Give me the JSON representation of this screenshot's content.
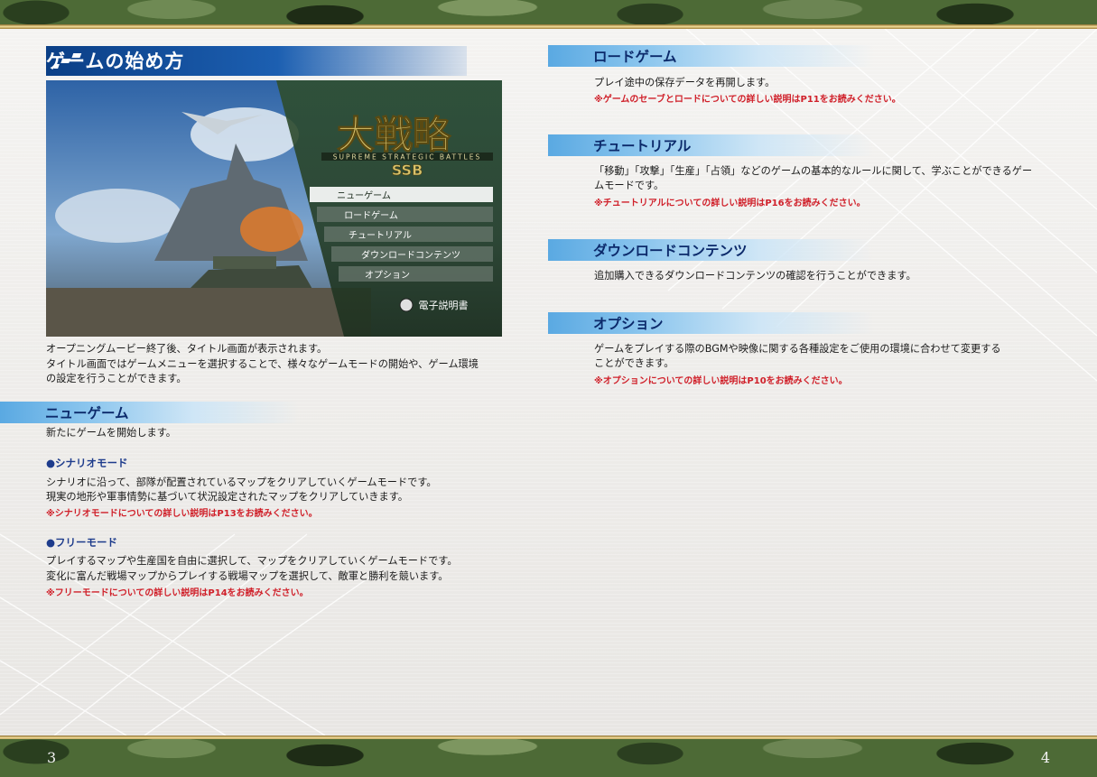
{
  "page": {
    "left_number": "3",
    "right_number": "4"
  },
  "left": {
    "title": "ゲームの始め方",
    "screenshot": {
      "logo_text": "大戦略",
      "logo_subtitle": "SUPREME STRATEGIC BATTLES",
      "logo_ssb": "SSB",
      "menu": [
        "ニューゲーム",
        "ロードゲーム",
        "チュートリアル",
        "ダウンロードコンテンツ",
        "オプション"
      ],
      "manual_label": "電子説明書"
    },
    "intro": [
      "オープニングムービー終了後、タイトル画面が表示されます。",
      "タイトル画面ではゲームメニューを選択することで、様々なゲームモードの開始や、ゲーム環境",
      "の設定を行うことができます。"
    ],
    "newgame": {
      "heading": "ニューゲーム",
      "desc": "新たにゲームを開始します。",
      "scenario": {
        "title": "●シナリオモード",
        "lines": [
          "シナリオに沿って、部隊が配置されているマップをクリアしていくゲームモードです。",
          "現実の地形や軍事情勢に基づいて状況設定されたマップをクリアしていきます。"
        ],
        "note": "※シナリオモードについての詳しい説明はP13をお読みください。"
      },
      "free": {
        "title": "●フリーモード",
        "lines": [
          "プレイするマップや生産国を自由に選択して、マップをクリアしていくゲームモードです。",
          "変化に富んだ戦場マップからプレイする戦場マップを選択して、敵軍と勝利を競います。"
        ],
        "note": "※フリーモードについての詳しい説明はP14をお読みください。"
      }
    }
  },
  "right": {
    "load": {
      "heading": "ロードゲーム",
      "lines": [
        "プレイ途中の保存データを再開します。"
      ],
      "note": "※ゲームのセーブとロードについての詳しい説明はP11をお読みください。"
    },
    "tutorial": {
      "heading": "チュートリアル",
      "lines": [
        "「移動」「攻撃」「生産」「占領」などのゲームの基本的なルールに関して、学ぶことができるゲー",
        "ムモードです。"
      ],
      "note": "※チュートリアルについての詳しい説明はP16をお読みください。"
    },
    "dlc": {
      "heading": "ダウンロードコンテンツ",
      "lines": [
        "追加購入できるダウンロードコンテンツの確認を行うことができます。"
      ]
    },
    "option": {
      "heading": "オプション",
      "lines": [
        "ゲームをプレイする際のBGMや映像に関する各種設定をご使用の環境に合わせて変更する",
        "ことができます。"
      ],
      "note": "※オプションについての詳しい説明はP10をお読みください。"
    }
  }
}
